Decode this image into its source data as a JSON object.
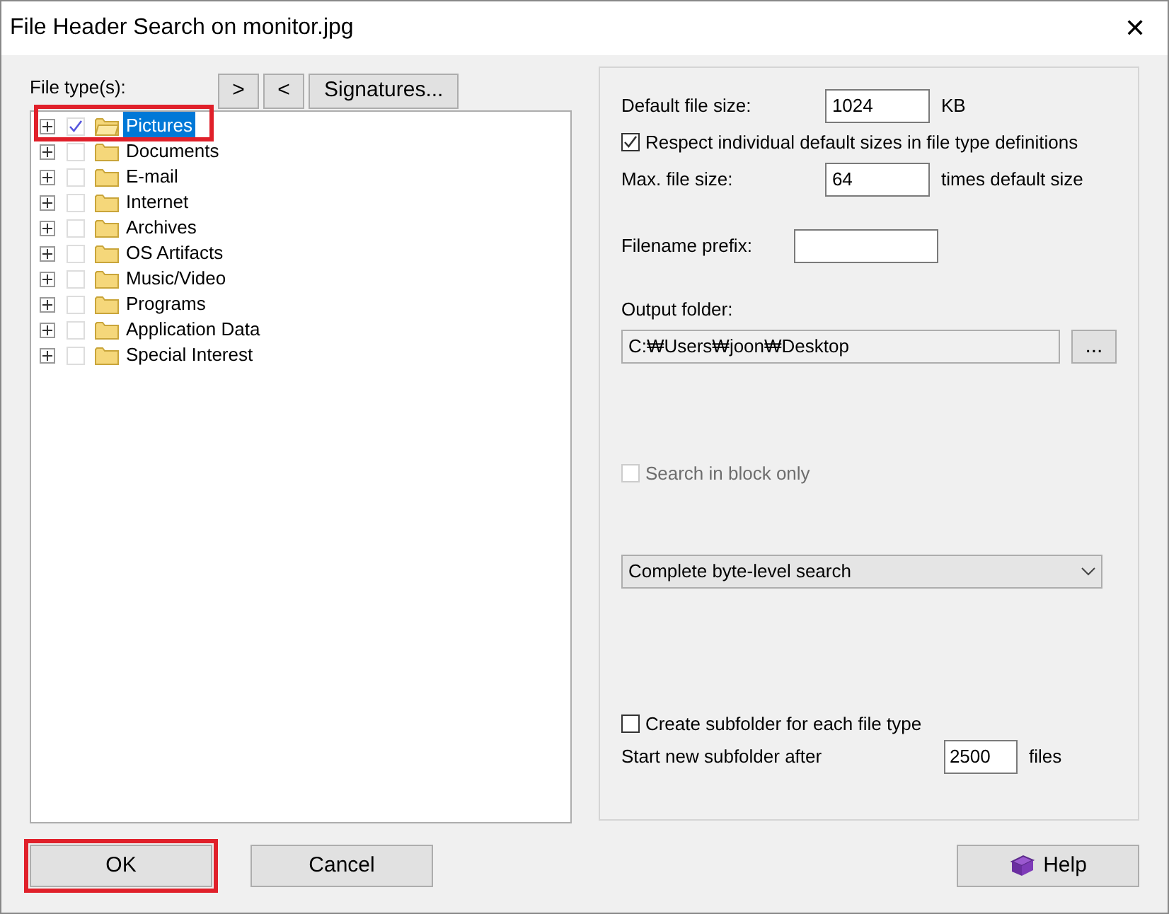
{
  "window": {
    "title": "File Header Search on monitor.jpg",
    "close": "✕"
  },
  "file_types": {
    "label": "File type(s):",
    "buttons": [
      ">",
      "<",
      "Signatures..."
    ],
    "items": [
      {
        "label": "Pictures",
        "checked": true,
        "selected": true,
        "expanded": false,
        "highlighted": true
      },
      {
        "label": "Documents",
        "checked": false,
        "selected": false,
        "expanded": false,
        "highlighted": false
      },
      {
        "label": "E-mail",
        "checked": false,
        "selected": false,
        "expanded": false,
        "highlighted": false
      },
      {
        "label": "Internet",
        "checked": false,
        "selected": false,
        "expanded": false,
        "highlighted": false
      },
      {
        "label": "Archives",
        "checked": false,
        "selected": false,
        "expanded": false,
        "highlighted": false
      },
      {
        "label": "OS Artifacts",
        "checked": false,
        "selected": false,
        "expanded": false,
        "highlighted": false
      },
      {
        "label": "Music/Video",
        "checked": false,
        "selected": false,
        "expanded": false,
        "highlighted": false
      },
      {
        "label": "Programs",
        "checked": false,
        "selected": false,
        "expanded": false,
        "highlighted": false
      },
      {
        "label": "Application Data",
        "checked": false,
        "selected": false,
        "expanded": false,
        "highlighted": false
      },
      {
        "label": "Special Interest",
        "checked": false,
        "selected": false,
        "expanded": false,
        "highlighted": false
      }
    ]
  },
  "options": {
    "default_file_size": {
      "label": "Default file size:",
      "value": "1024",
      "unit": "KB"
    },
    "respect_defaults": {
      "label": "Respect individual default sizes in file type definitions",
      "checked": true
    },
    "max_file_size": {
      "label": "Max. file size:",
      "value": "64",
      "unit": "times default size"
    },
    "filename_prefix": {
      "label": "Filename prefix:"
    },
    "output_folder": {
      "label": "Output folder:",
      "value": "C:₩Users₩joon₩Desktop",
      "browse": "..."
    },
    "search_in_block": {
      "label": "Search in block only",
      "checked": false,
      "disabled": true
    },
    "search_mode": {
      "value": "Complete byte-level search"
    },
    "create_subfolder": {
      "label": "Create subfolder for each file type",
      "checked": false
    },
    "new_subfolder": {
      "label": "Start new subfolder after",
      "value": "2500",
      "unit": "files"
    }
  },
  "buttons": [
    {
      "label": "OK",
      "kind": "ok",
      "highlighted": true
    },
    {
      "label": "Cancel",
      "kind": "cancel",
      "highlighted": false
    },
    {
      "label": "Help",
      "kind": "help",
      "highlighted": false
    }
  ]
}
